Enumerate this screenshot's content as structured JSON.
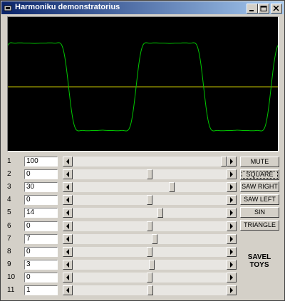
{
  "window": {
    "title": "Harmoniku demonstratorius"
  },
  "harmonics": [
    {
      "index": "1",
      "value": "100",
      "level": 1.0
    },
    {
      "index": "2",
      "value": "0",
      "level": 0.5
    },
    {
      "index": "3",
      "value": "30",
      "level": 0.65
    },
    {
      "index": "4",
      "value": "0",
      "level": 0.5
    },
    {
      "index": "5",
      "value": "14",
      "level": 0.57
    },
    {
      "index": "6",
      "value": "0",
      "level": 0.5
    },
    {
      "index": "7",
      "value": "7",
      "level": 0.535
    },
    {
      "index": "8",
      "value": "0",
      "level": 0.5
    },
    {
      "index": "9",
      "value": "3",
      "level": 0.515
    },
    {
      "index": "10",
      "value": "0",
      "level": 0.5
    },
    {
      "index": "11",
      "value": "1",
      "level": 0.505
    }
  ],
  "buttons": {
    "mute": "MUTE",
    "square": "SQUARE",
    "saw_right": "SAW RIGHT",
    "saw_left": "SAW LEFT",
    "sin": "SIN",
    "triangle": "TRIANGLE"
  },
  "brand": {
    "line1": "SAVEL",
    "line2": "TOYS"
  },
  "colors": {
    "wave": "#00c800",
    "axis": "#c8c800",
    "scope_bg": "#000000",
    "title_start": "#0a246a",
    "title_end": "#a6caf0"
  }
}
